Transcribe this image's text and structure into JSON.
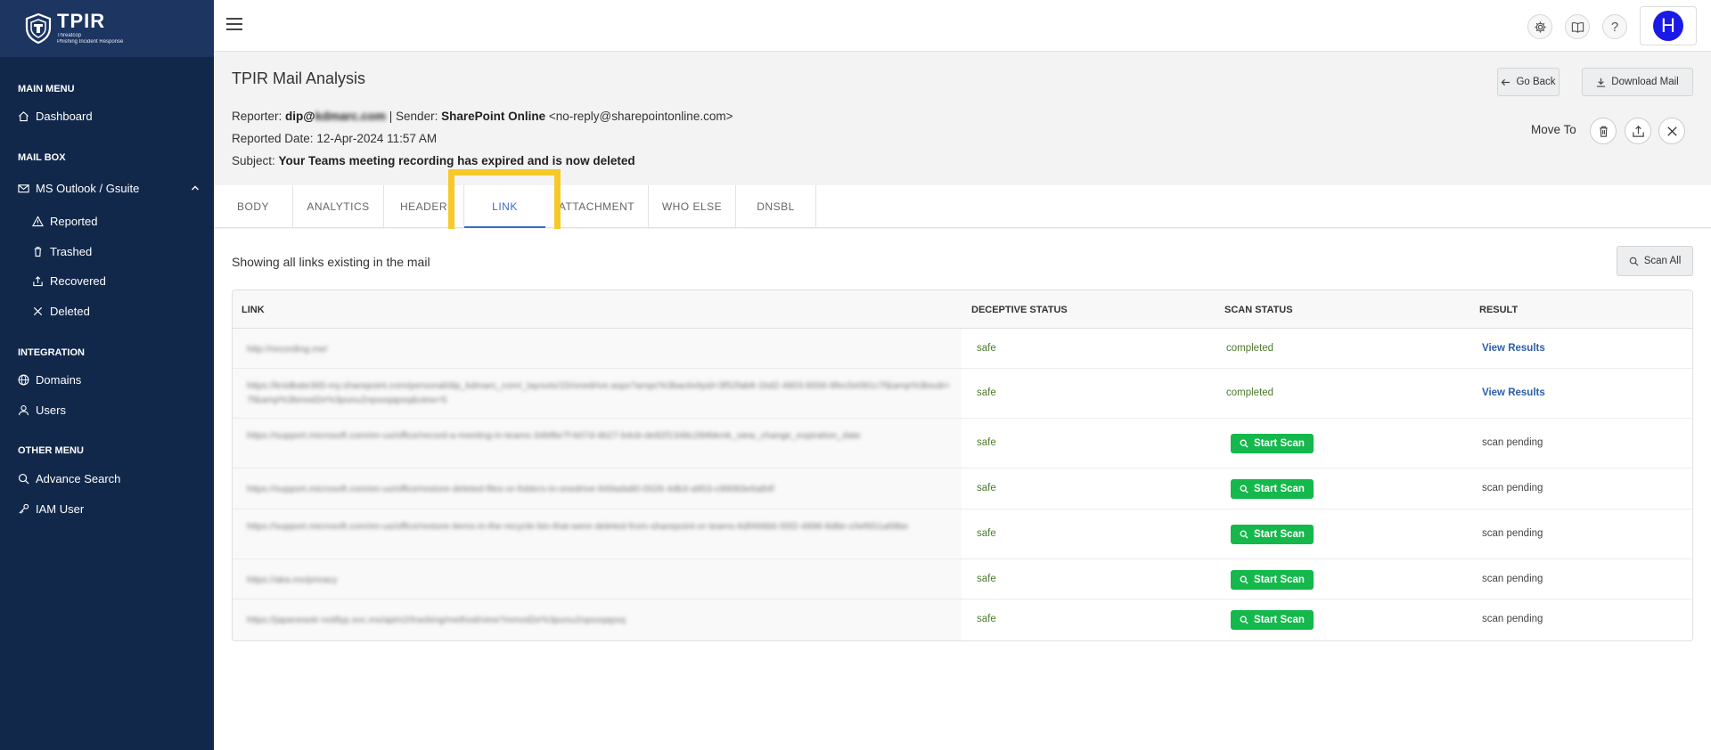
{
  "brand": {
    "name": "TPIR",
    "subtitle_line1": "Threatcop",
    "subtitle_line2": "Phishing Incident Response"
  },
  "sidebar": {
    "main_menu_label": "MAIN MENU",
    "dashboard": "Dashboard",
    "mailbox_label": "MAIL BOX",
    "ms_outlook": "MS Outlook / Gsuite",
    "reported": "Reported",
    "trashed": "Trashed",
    "recovered": "Recovered",
    "deleted": "Deleted",
    "integration_label": "INTEGRATION",
    "domains": "Domains",
    "users": "Users",
    "other_menu_label": "OTHER MENU",
    "advance_search": "Advance Search",
    "iam_user": "IAM User"
  },
  "topbar": {
    "avatar_letter": "H",
    "help_glyph": "?"
  },
  "header": {
    "title": "TPIR Mail Analysis",
    "reporter_label": "Reporter:",
    "reporter_prefix": "dip@",
    "reporter_blurred": "kdmarc.com",
    "sender_label": "| Sender:",
    "sender_name": "SharePoint Online",
    "sender_email": "<no-reply@sharepointonline.com>",
    "reported_date_label": "Reported Date:",
    "reported_date": "12-Apr-2024 11:57 AM",
    "subject_label": "Subject:",
    "subject": "Your Teams meeting recording has expired and is now deleted",
    "go_back": "Go Back",
    "download_mail": "Download Mail",
    "move_to": "Move To"
  },
  "tabs": [
    "BODY",
    "ANALYTICS",
    "HEADER",
    "LINK",
    "ATTACHMENT",
    "WHO ELSE",
    "DNSBL"
  ],
  "active_tab": "LINK",
  "content": {
    "showing_text": "Showing all links existing in the mail",
    "scan_all": "Scan All",
    "columns": [
      "LINK",
      "DECEPTIVE STATUS",
      "SCAN STATUS",
      "RESULT"
    ],
    "start_scan_label": "Start Scan",
    "rows": [
      {
        "link": "http://recording.me/",
        "deceptive": "safe",
        "scan_status": "completed",
        "result": "View Results"
      },
      {
        "link": "https://knidkate365-my.sharepoint.com/personal/dip_kdmarc_com/_layouts/15/onedrive.aspx?ampc%3bactivityid=3f52fab8-1bd2-4803-8556-8fec5e081c7f&amp%3bsub=7f&amp%3bmod2e%3punu2npxxqapxq&view=5",
        "deceptive": "safe",
        "scan_status": "completed",
        "result": "View Results"
      },
      {
        "link": "https://support.microsoft.com/en-us/office/record-a-meeting-in-teams-34bf8e7f-b07d-4b27-b4cb-de82f1348c28#bkmk_view_change_expiration_date",
        "deceptive": "safe",
        "scan_status": "start_scan",
        "result": "scan pending"
      },
      {
        "link": "https://support.microsoft.com/en-us/office/restore-deleted-files-or-folders-in-onedrive-949ada80-0026-4db3-a953-c99083e6a84f",
        "deceptive": "safe",
        "scan_status": "start_scan",
        "result": "scan pending"
      },
      {
        "link": "https://support.microsoft.com/en-us/office/restore-items-in-the-recycle-bin-that-were-deleted-from-sharepoint-or-teams-6df466b6-55f2-4898-8d8e-c0ef651a68be",
        "deceptive": "safe",
        "scan_status": "start_scan",
        "result": "scan pending"
      },
      {
        "link": "https://aka.ms/privacy",
        "deceptive": "safe",
        "scan_status": "start_scan",
        "result": "scan pending"
      },
      {
        "link": "https://japaneastr-notifyp.svc.ms/api/v2/tracking/method/view?mmod2e%3punu2npxxqapxq",
        "deceptive": "safe",
        "scan_status": "start_scan",
        "result": "scan pending"
      }
    ]
  }
}
